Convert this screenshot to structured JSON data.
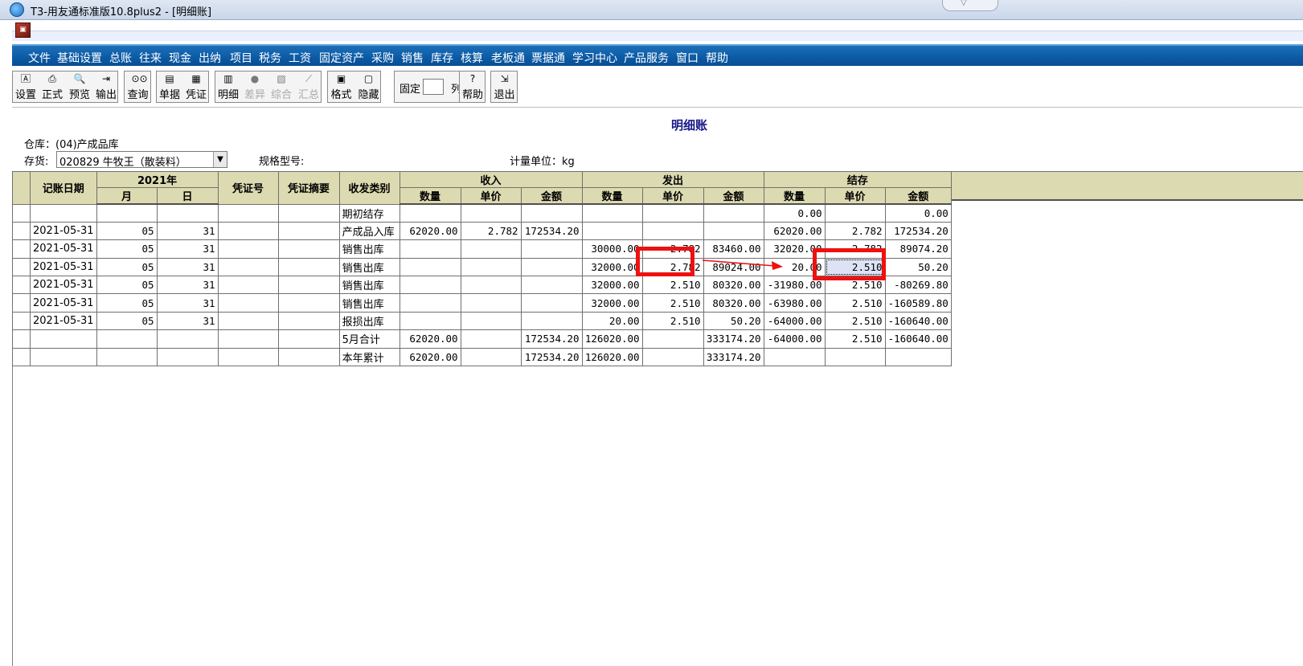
{
  "window": {
    "title": "T3-用友通标准版10.8plus2 - [明细账]"
  },
  "menu": [
    "文件",
    "基础设置",
    "总账",
    "往来",
    "现金",
    "出纳",
    "项目",
    "税务",
    "工资",
    "固定资产",
    "采购",
    "销售",
    "库存",
    "核算",
    "老板通",
    "票据通",
    "学习中心",
    "产品服务",
    "窗口",
    "帮助"
  ],
  "toolbar": {
    "buttons": [
      {
        "label": "设置",
        "icon": "settings-icon",
        "enabled": true
      },
      {
        "label": "正式",
        "icon": "printer-icon",
        "enabled": true
      },
      {
        "label": "预览",
        "icon": "preview-icon",
        "enabled": true
      },
      {
        "label": "输出",
        "icon": "export-icon",
        "enabled": true
      },
      {
        "label": "查询",
        "icon": "binoculars-icon",
        "enabled": true
      },
      {
        "label": "单据",
        "icon": "document-icon",
        "enabled": true
      },
      {
        "label": "凭证",
        "icon": "voucher-icon",
        "enabled": true
      },
      {
        "label": "明细",
        "icon": "detail-icon",
        "enabled": true
      },
      {
        "label": "差异",
        "icon": "difference-icon",
        "enabled": false
      },
      {
        "label": "综合",
        "icon": "summary-icon",
        "enabled": false
      },
      {
        "label": "汇总",
        "icon": "chart-icon",
        "enabled": false
      },
      {
        "label": "格式",
        "icon": "format-icon",
        "enabled": true
      },
      {
        "label": "隐藏",
        "icon": "hide-icon",
        "enabled": true
      },
      {
        "label": "帮助",
        "icon": "help-icon",
        "enabled": true
      },
      {
        "label": "退出",
        "icon": "exit-icon",
        "enabled": true
      }
    ],
    "fixed_label": "固定",
    "fixed_value": "",
    "column_label": "列"
  },
  "report": {
    "title": "明细账",
    "warehouse": "仓库：(04)产成品库",
    "inventory_label": "存货:",
    "inventory_value": "020829 牛牧王（散装料）",
    "spec_label": "规格型号:",
    "unit_label": "计量单位：kg"
  },
  "table": {
    "headers": {
      "date": "记账日期",
      "year": "2021年",
      "month": "月",
      "day": "日",
      "voucher_no": "凭证号",
      "summary": "凭证摘要",
      "category": "收发类别",
      "in": "收入",
      "out": "发出",
      "balance": "结存",
      "qty": "数量",
      "price": "单价",
      "amount": "金额"
    },
    "rows": [
      [
        "",
        "",
        "",
        "",
        "",
        "期初结存",
        "",
        "",
        "",
        "",
        "",
        "",
        "0.00",
        "",
        "0.00"
      ],
      [
        "2021-05-31",
        "05",
        "31",
        "",
        "",
        "产成品入库",
        "62020.00",
        "2.782",
        "172534.20",
        "",
        "",
        "",
        "62020.00",
        "2.782",
        "172534.20"
      ],
      [
        "2021-05-31",
        "05",
        "31",
        "",
        "",
        "销售出库",
        "",
        "",
        "",
        "30000.00",
        "2.782",
        "83460.00",
        "32020.00",
        "2.782",
        "89074.20"
      ],
      [
        "2021-05-31",
        "05",
        "31",
        "",
        "",
        "销售出库",
        "",
        "",
        "",
        "32000.00",
        "2.782",
        "89024.00",
        "20.00",
        "2.510",
        "50.20"
      ],
      [
        "2021-05-31",
        "05",
        "31",
        "",
        "",
        "销售出库",
        "",
        "",
        "",
        "32000.00",
        "2.510",
        "80320.00",
        "-31980.00",
        "2.510",
        "-80269.80"
      ],
      [
        "2021-05-31",
        "05",
        "31",
        "",
        "",
        "销售出库",
        "",
        "",
        "",
        "32000.00",
        "2.510",
        "80320.00",
        "-63980.00",
        "2.510",
        "-160589.80"
      ],
      [
        "2021-05-31",
        "05",
        "31",
        "",
        "",
        "报损出库",
        "",
        "",
        "",
        "20.00",
        "2.510",
        "50.20",
        "-64000.00",
        "2.510",
        "-160640.00"
      ],
      [
        "",
        "",
        "",
        "",
        "",
        "5月合计",
        "62020.00",
        "",
        "172534.20",
        "126020.00",
        "",
        "333174.20",
        "-64000.00",
        "2.510",
        "-160640.00"
      ],
      [
        "",
        "",
        "",
        "",
        "",
        "本年累计",
        "62020.00",
        "",
        "172534.20",
        "126020.00",
        "",
        "333174.20",
        "",
        "",
        ""
      ]
    ]
  },
  "colors": {
    "menubar": "#0b5aa5",
    "grid_header": "#dcdab0",
    "annotation": "#ee1111",
    "title": "#1a1a8a"
  }
}
